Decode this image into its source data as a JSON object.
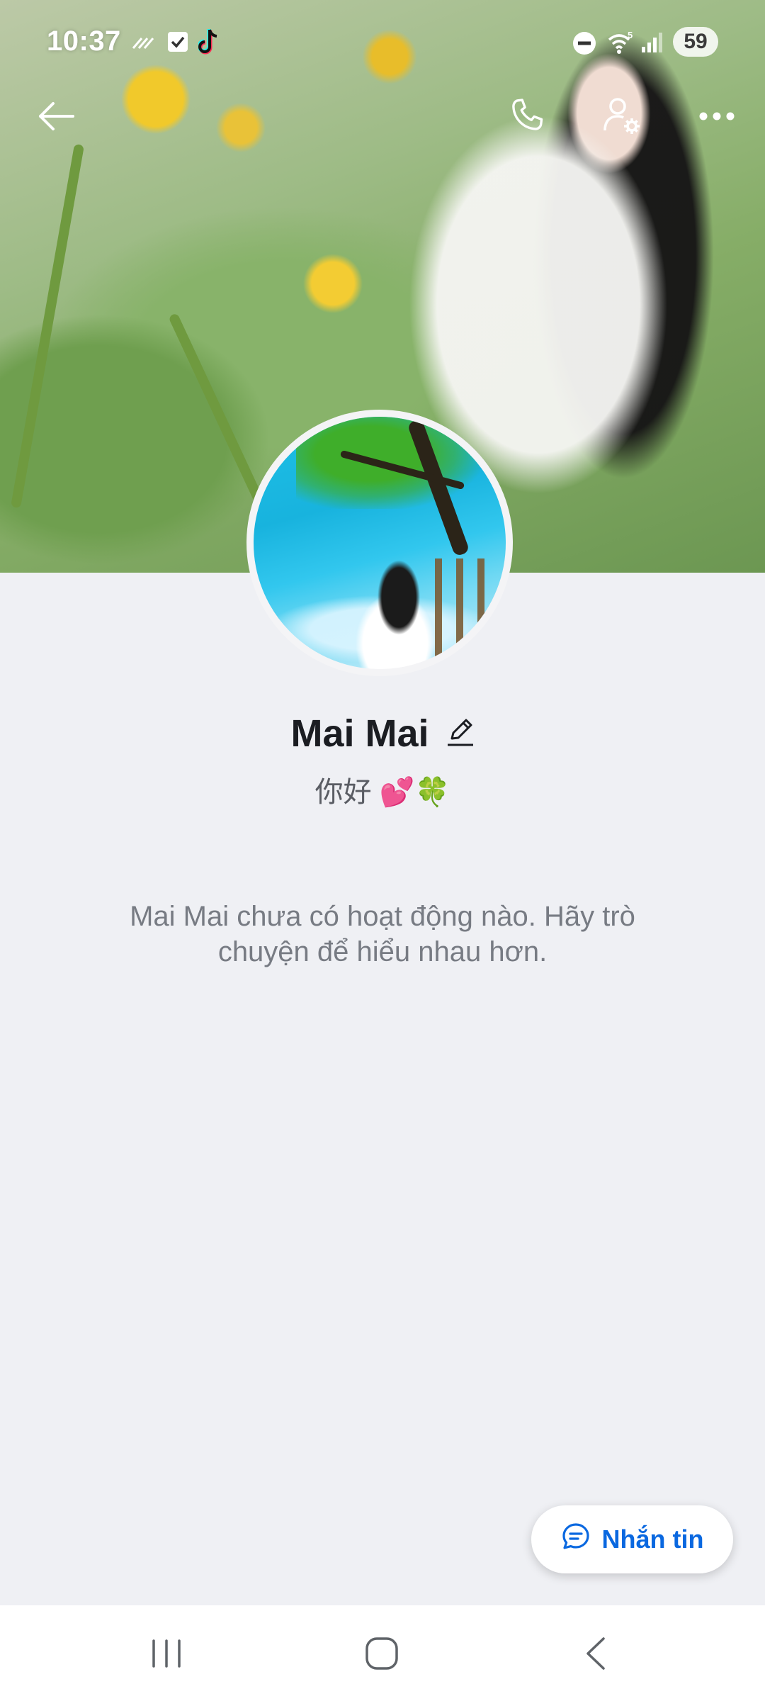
{
  "status_bar": {
    "time": "10:37",
    "battery": "59",
    "icons": [
      "hashtag-stripes-icon",
      "checkbox-icon",
      "tiktok-icon",
      "do-not-disturb-icon",
      "wifi-icon",
      "signal-icon",
      "battery-icon"
    ]
  },
  "top_bar": {
    "icons": [
      "back-arrow-icon",
      "phone-icon",
      "user-settings-icon",
      "more-icon"
    ]
  },
  "profile": {
    "name": "Mai Mai",
    "bio": "你好 💕🍀",
    "empty_activity_message": "Mai Mai chưa có hoạt động nào. Hãy trò chuyện để hiểu nhau hơn."
  },
  "actions": {
    "message_label": "Nhắn tin"
  },
  "nav_bar": {
    "icons": [
      "recent-apps-icon",
      "home-icon",
      "back-icon"
    ]
  },
  "colors": {
    "background": "#eff0f4",
    "accent": "#0a68e0",
    "name_text": "#1b1d22",
    "secondary_text": "#777b83"
  }
}
